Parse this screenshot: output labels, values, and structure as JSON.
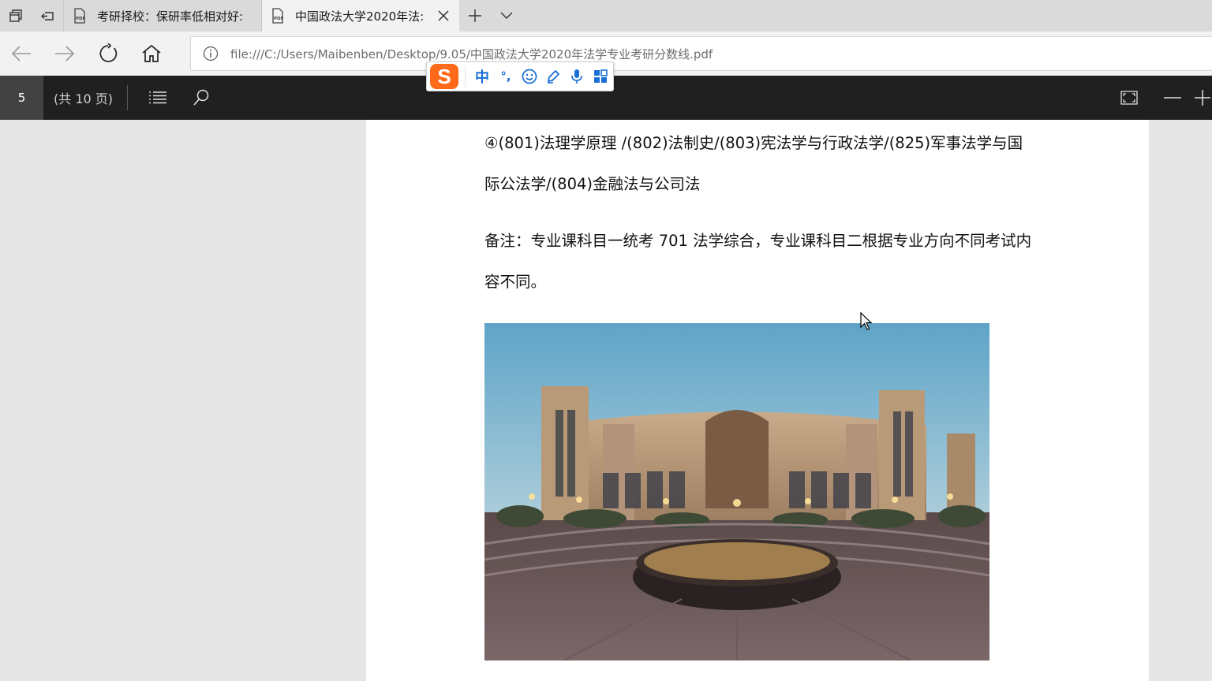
{
  "tabs": [
    {
      "title": "考研择校：保研率低相对好:",
      "icon": "pdf-icon",
      "active": false
    },
    {
      "title": "中国政法大学2020年法:",
      "icon": "pdf-icon",
      "active": true
    }
  ],
  "address": {
    "url": "file:///C:/Users/Maibenben/Desktop/9.05/中国政法大学2020年法学专业考研分数线.pdf"
  },
  "pdf_toolbar": {
    "current_page": "5",
    "page_count_text": "(共 10 页)"
  },
  "ime_toolbar": {
    "logo": "S",
    "mode": "中",
    "punct": "°,"
  },
  "document": {
    "paragraph1": "④(801)法理学原理 /(802)法制史/(803)宪法学与行政法学/(825)军事法学与国际公法学/(804)金融法与公司法",
    "paragraph2": "备注：专业课科目一统考 701 法学综合，专业课科目二根据专业方向不同考试内容不同。"
  },
  "colors": {
    "tabbar_bg": "#dadada",
    "active_tab_bg": "#f2f2f2",
    "pdf_toolbar_bg": "#202020",
    "page_box_bg": "#424242",
    "ime_accent": "#1a6fd6",
    "ime_logo": "#ff6a1a"
  }
}
